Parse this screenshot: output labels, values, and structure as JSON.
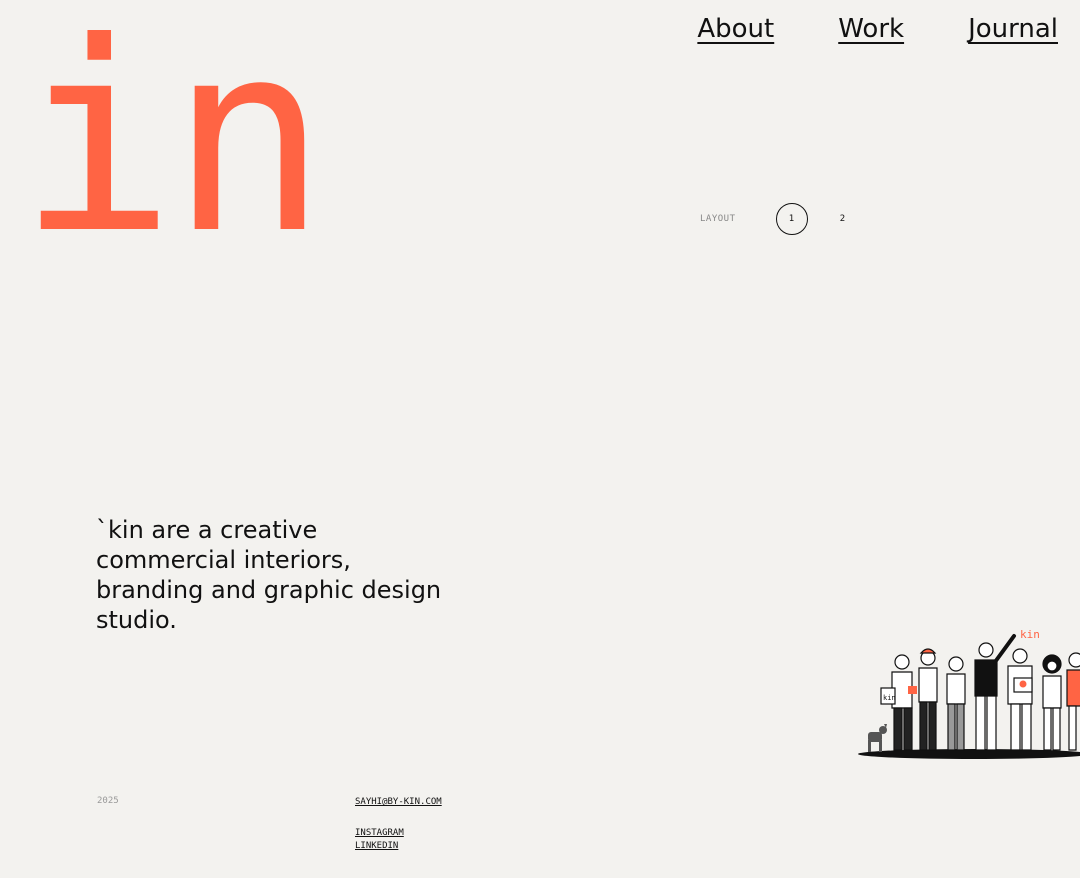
{
  "brand": {
    "logo_text": "in"
  },
  "nav": {
    "items": [
      "About",
      "Work",
      "Journal"
    ]
  },
  "layout": {
    "label": "LAYOUT",
    "options": [
      "1",
      "2"
    ],
    "selected": "1"
  },
  "hero": {
    "tagline": "`kin are a creative commercial interiors, branding and graphic design studio."
  },
  "footer": {
    "year": "2025",
    "email": "SAYHI@BY-KIN.COM",
    "social": [
      "INSTAGRAM",
      "LINKEDIN"
    ]
  },
  "illustration": {
    "sign_text": "kin",
    "bag_text": "kin"
  },
  "colors": {
    "accent": "#ff6444",
    "background": "#f3f2ef",
    "text": "#111111"
  }
}
